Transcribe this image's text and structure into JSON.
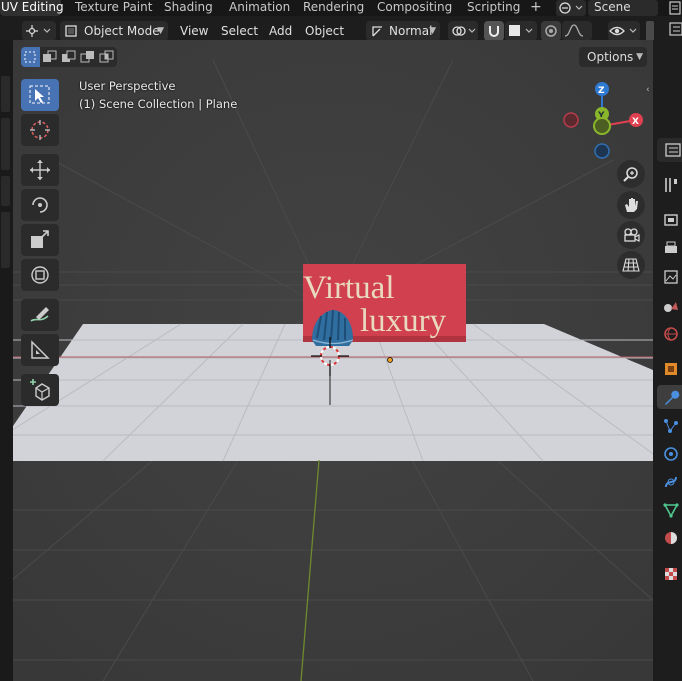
{
  "workspaces": {
    "tabs": [
      "UV Editing",
      "Texture Paint",
      "Shading",
      "Animation",
      "Rendering",
      "Compositing",
      "Scripting"
    ],
    "active": "UV Editing",
    "add_symbol": "+",
    "scene_name": "Scene"
  },
  "header": {
    "mode_label": "Object Mode",
    "menus": [
      "View",
      "Select",
      "Add",
      "Object"
    ],
    "transform_orientation": "Normal"
  },
  "viewport": {
    "perspective_label": "User Perspective",
    "collection_label": "(1) Scene Collection | Plane",
    "options_label": "Options",
    "gizmo": {
      "x_label": "X",
      "y_label": "Y",
      "z_label": "Z"
    },
    "billboard": {
      "line1": "Virtual",
      "line2": "luxury",
      "color": "#d0404e"
    },
    "floor_color": "#d2d3d8",
    "object_color": "#2d6a9a"
  },
  "colors": {
    "active_tool": "#4772b3",
    "axis_x": "#e0404f",
    "axis_y": "#8ab62c",
    "axis_z": "#2f7ad1"
  }
}
